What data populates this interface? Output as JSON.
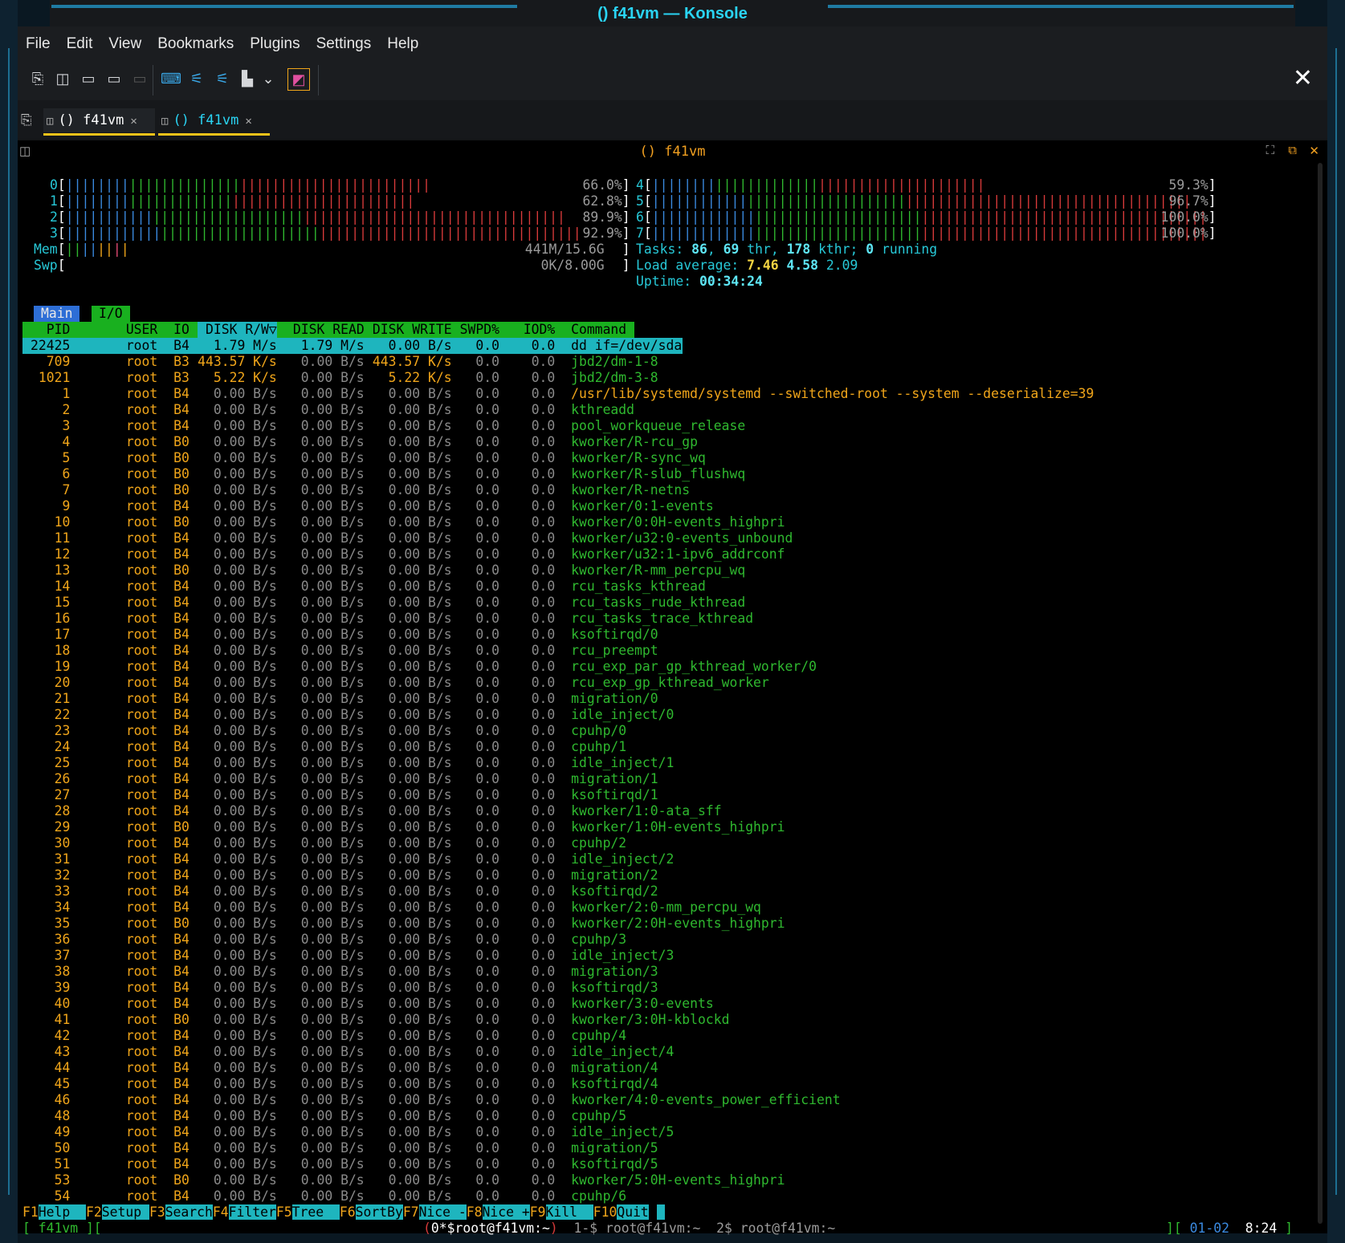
{
  "window": {
    "title": "() f41vm — Konsole"
  },
  "menu": [
    "File",
    "Edit",
    "View",
    "Bookmarks",
    "Plugins",
    "Settings",
    "Help"
  ],
  "toolbar_icons": [
    "new-tab-icon",
    "split-view-icon",
    "open-folder-icon",
    "save-icon",
    "disabled-icon",
    "keyboard-icon",
    "sliders-icon",
    "sliders-alt-icon",
    "chart-icon",
    "chevron-down-icon",
    "profile-icon"
  ],
  "tabs": [
    {
      "label": "() f41vm",
      "active": true
    },
    {
      "label": "() f41vm",
      "active": false
    }
  ],
  "terminal_title": "() f41vm",
  "cpus": [
    {
      "id": "0",
      "pct": "66.0%",
      "fill": 0.66
    },
    {
      "id": "1",
      "pct": "62.8%",
      "fill": 0.628
    },
    {
      "id": "2",
      "pct": "89.9%",
      "fill": 0.899
    },
    {
      "id": "3",
      "pct": "92.9%",
      "fill": 0.929
    },
    {
      "id": "4",
      "pct": "59.3%",
      "fill": 0.593
    },
    {
      "id": "5",
      "pct": "96.7%",
      "fill": 0.967
    },
    {
      "id": "6",
      "pct": "100.0%",
      "fill": 1.0
    },
    {
      "id": "7",
      "pct": "100.0%",
      "fill": 1.0
    }
  ],
  "mem": {
    "label": "Mem",
    "value": "441M/15.6G"
  },
  "swp": {
    "label": "Swp",
    "value": "0K/8.00G"
  },
  "tasks": {
    "label": "Tasks:",
    "count": "86",
    "thr": "69",
    "thr_label": "thr,",
    "kthr": "178",
    "kthr_label": "kthr;",
    "running": "0",
    "running_label": "running"
  },
  "load": {
    "label": "Load average:",
    "l1": "7.46",
    "l5": "4.58",
    "l15": "2.09"
  },
  "uptime": {
    "label": "Uptime:",
    "value": "00:34:24"
  },
  "screen_tabs": [
    "Main",
    "I/O"
  ],
  "columns": {
    "pid": "PID",
    "user": "USER",
    "io": "IO",
    "rw": "DISK R/W▽",
    "read": "DISK READ",
    "write": "DISK WRITE",
    "swpd": "SWPD%",
    "iod": "IOD%",
    "cmd": "Command"
  },
  "processes": [
    {
      "pid": "22425",
      "user": "root",
      "io": "B4",
      "rw": "1.79 M/s",
      "read": "1.79 M/s",
      "write": "0.00 B/s",
      "swpd": "0.0",
      "iod": "0.0",
      "cmd": "dd if=/dev/sda"
    },
    {
      "pid": "709",
      "user": "root",
      "io": "B3",
      "rw": "443.57 K/s",
      "read": "0.00 B/s",
      "write": "443.57 K/s",
      "swpd": "0.0",
      "iod": "0.0",
      "cmd": "jbd2/dm-1-8"
    },
    {
      "pid": "1021",
      "user": "root",
      "io": "B3",
      "rw": "5.22 K/s",
      "read": "0.00 B/s",
      "write": "5.22 K/s",
      "swpd": "0.0",
      "iod": "0.0",
      "cmd": "jbd2/dm-3-8"
    },
    {
      "pid": "1",
      "user": "root",
      "io": "B4",
      "rw": "0.00 B/s",
      "read": "0.00 B/s",
      "write": "0.00 B/s",
      "swpd": "0.0",
      "iod": "0.0",
      "cmd": "/usr/lib/systemd/systemd --switched-root --system --deserialize=39"
    },
    {
      "pid": "2",
      "user": "root",
      "io": "B4",
      "rw": "0.00 B/s",
      "read": "0.00 B/s",
      "write": "0.00 B/s",
      "swpd": "0.0",
      "iod": "0.0",
      "cmd": "kthreadd"
    },
    {
      "pid": "3",
      "user": "root",
      "io": "B4",
      "rw": "0.00 B/s",
      "read": "0.00 B/s",
      "write": "0.00 B/s",
      "swpd": "0.0",
      "iod": "0.0",
      "cmd": "pool_workqueue_release"
    },
    {
      "pid": "4",
      "user": "root",
      "io": "B0",
      "rw": "0.00 B/s",
      "read": "0.00 B/s",
      "write": "0.00 B/s",
      "swpd": "0.0",
      "iod": "0.0",
      "cmd": "kworker/R-rcu_gp"
    },
    {
      "pid": "5",
      "user": "root",
      "io": "B0",
      "rw": "0.00 B/s",
      "read": "0.00 B/s",
      "write": "0.00 B/s",
      "swpd": "0.0",
      "iod": "0.0",
      "cmd": "kworker/R-sync_wq"
    },
    {
      "pid": "6",
      "user": "root",
      "io": "B0",
      "rw": "0.00 B/s",
      "read": "0.00 B/s",
      "write": "0.00 B/s",
      "swpd": "0.0",
      "iod": "0.0",
      "cmd": "kworker/R-slub_flushwq"
    },
    {
      "pid": "7",
      "user": "root",
      "io": "B0",
      "rw": "0.00 B/s",
      "read": "0.00 B/s",
      "write": "0.00 B/s",
      "swpd": "0.0",
      "iod": "0.0",
      "cmd": "kworker/R-netns"
    },
    {
      "pid": "9",
      "user": "root",
      "io": "B4",
      "rw": "0.00 B/s",
      "read": "0.00 B/s",
      "write": "0.00 B/s",
      "swpd": "0.0",
      "iod": "0.0",
      "cmd": "kworker/0:1-events"
    },
    {
      "pid": "10",
      "user": "root",
      "io": "B0",
      "rw": "0.00 B/s",
      "read": "0.00 B/s",
      "write": "0.00 B/s",
      "swpd": "0.0",
      "iod": "0.0",
      "cmd": "kworker/0:0H-events_highpri"
    },
    {
      "pid": "11",
      "user": "root",
      "io": "B4",
      "rw": "0.00 B/s",
      "read": "0.00 B/s",
      "write": "0.00 B/s",
      "swpd": "0.0",
      "iod": "0.0",
      "cmd": "kworker/u32:0-events_unbound"
    },
    {
      "pid": "12",
      "user": "root",
      "io": "B4",
      "rw": "0.00 B/s",
      "read": "0.00 B/s",
      "write": "0.00 B/s",
      "swpd": "0.0",
      "iod": "0.0",
      "cmd": "kworker/u32:1-ipv6_addrconf"
    },
    {
      "pid": "13",
      "user": "root",
      "io": "B0",
      "rw": "0.00 B/s",
      "read": "0.00 B/s",
      "write": "0.00 B/s",
      "swpd": "0.0",
      "iod": "0.0",
      "cmd": "kworker/R-mm_percpu_wq"
    },
    {
      "pid": "14",
      "user": "root",
      "io": "B4",
      "rw": "0.00 B/s",
      "read": "0.00 B/s",
      "write": "0.00 B/s",
      "swpd": "0.0",
      "iod": "0.0",
      "cmd": "rcu_tasks_kthread"
    },
    {
      "pid": "15",
      "user": "root",
      "io": "B4",
      "rw": "0.00 B/s",
      "read": "0.00 B/s",
      "write": "0.00 B/s",
      "swpd": "0.0",
      "iod": "0.0",
      "cmd": "rcu_tasks_rude_kthread"
    },
    {
      "pid": "16",
      "user": "root",
      "io": "B4",
      "rw": "0.00 B/s",
      "read": "0.00 B/s",
      "write": "0.00 B/s",
      "swpd": "0.0",
      "iod": "0.0",
      "cmd": "rcu_tasks_trace_kthread"
    },
    {
      "pid": "17",
      "user": "root",
      "io": "B4",
      "rw": "0.00 B/s",
      "read": "0.00 B/s",
      "write": "0.00 B/s",
      "swpd": "0.0",
      "iod": "0.0",
      "cmd": "ksoftirqd/0"
    },
    {
      "pid": "18",
      "user": "root",
      "io": "B4",
      "rw": "0.00 B/s",
      "read": "0.00 B/s",
      "write": "0.00 B/s",
      "swpd": "0.0",
      "iod": "0.0",
      "cmd": "rcu_preempt"
    },
    {
      "pid": "19",
      "user": "root",
      "io": "B4",
      "rw": "0.00 B/s",
      "read": "0.00 B/s",
      "write": "0.00 B/s",
      "swpd": "0.0",
      "iod": "0.0",
      "cmd": "rcu_exp_par_gp_kthread_worker/0"
    },
    {
      "pid": "20",
      "user": "root",
      "io": "B4",
      "rw": "0.00 B/s",
      "read": "0.00 B/s",
      "write": "0.00 B/s",
      "swpd": "0.0",
      "iod": "0.0",
      "cmd": "rcu_exp_gp_kthread_worker"
    },
    {
      "pid": "21",
      "user": "root",
      "io": "B4",
      "rw": "0.00 B/s",
      "read": "0.00 B/s",
      "write": "0.00 B/s",
      "swpd": "0.0",
      "iod": "0.0",
      "cmd": "migration/0"
    },
    {
      "pid": "22",
      "user": "root",
      "io": "B4",
      "rw": "0.00 B/s",
      "read": "0.00 B/s",
      "write": "0.00 B/s",
      "swpd": "0.0",
      "iod": "0.0",
      "cmd": "idle_inject/0"
    },
    {
      "pid": "23",
      "user": "root",
      "io": "B4",
      "rw": "0.00 B/s",
      "read": "0.00 B/s",
      "write": "0.00 B/s",
      "swpd": "0.0",
      "iod": "0.0",
      "cmd": "cpuhp/0"
    },
    {
      "pid": "24",
      "user": "root",
      "io": "B4",
      "rw": "0.00 B/s",
      "read": "0.00 B/s",
      "write": "0.00 B/s",
      "swpd": "0.0",
      "iod": "0.0",
      "cmd": "cpuhp/1"
    },
    {
      "pid": "25",
      "user": "root",
      "io": "B4",
      "rw": "0.00 B/s",
      "read": "0.00 B/s",
      "write": "0.00 B/s",
      "swpd": "0.0",
      "iod": "0.0",
      "cmd": "idle_inject/1"
    },
    {
      "pid": "26",
      "user": "root",
      "io": "B4",
      "rw": "0.00 B/s",
      "read": "0.00 B/s",
      "write": "0.00 B/s",
      "swpd": "0.0",
      "iod": "0.0",
      "cmd": "migration/1"
    },
    {
      "pid": "27",
      "user": "root",
      "io": "B4",
      "rw": "0.00 B/s",
      "read": "0.00 B/s",
      "write": "0.00 B/s",
      "swpd": "0.0",
      "iod": "0.0",
      "cmd": "ksoftirqd/1"
    },
    {
      "pid": "28",
      "user": "root",
      "io": "B4",
      "rw": "0.00 B/s",
      "read": "0.00 B/s",
      "write": "0.00 B/s",
      "swpd": "0.0",
      "iod": "0.0",
      "cmd": "kworker/1:0-ata_sff"
    },
    {
      "pid": "29",
      "user": "root",
      "io": "B0",
      "rw": "0.00 B/s",
      "read": "0.00 B/s",
      "write": "0.00 B/s",
      "swpd": "0.0",
      "iod": "0.0",
      "cmd": "kworker/1:0H-events_highpri"
    },
    {
      "pid": "30",
      "user": "root",
      "io": "B4",
      "rw": "0.00 B/s",
      "read": "0.00 B/s",
      "write": "0.00 B/s",
      "swpd": "0.0",
      "iod": "0.0",
      "cmd": "cpuhp/2"
    },
    {
      "pid": "31",
      "user": "root",
      "io": "B4",
      "rw": "0.00 B/s",
      "read": "0.00 B/s",
      "write": "0.00 B/s",
      "swpd": "0.0",
      "iod": "0.0",
      "cmd": "idle_inject/2"
    },
    {
      "pid": "32",
      "user": "root",
      "io": "B4",
      "rw": "0.00 B/s",
      "read": "0.00 B/s",
      "write": "0.00 B/s",
      "swpd": "0.0",
      "iod": "0.0",
      "cmd": "migration/2"
    },
    {
      "pid": "33",
      "user": "root",
      "io": "B4",
      "rw": "0.00 B/s",
      "read": "0.00 B/s",
      "write": "0.00 B/s",
      "swpd": "0.0",
      "iod": "0.0",
      "cmd": "ksoftirqd/2"
    },
    {
      "pid": "34",
      "user": "root",
      "io": "B4",
      "rw": "0.00 B/s",
      "read": "0.00 B/s",
      "write": "0.00 B/s",
      "swpd": "0.0",
      "iod": "0.0",
      "cmd": "kworker/2:0-mm_percpu_wq"
    },
    {
      "pid": "35",
      "user": "root",
      "io": "B0",
      "rw": "0.00 B/s",
      "read": "0.00 B/s",
      "write": "0.00 B/s",
      "swpd": "0.0",
      "iod": "0.0",
      "cmd": "kworker/2:0H-events_highpri"
    },
    {
      "pid": "36",
      "user": "root",
      "io": "B4",
      "rw": "0.00 B/s",
      "read": "0.00 B/s",
      "write": "0.00 B/s",
      "swpd": "0.0",
      "iod": "0.0",
      "cmd": "cpuhp/3"
    },
    {
      "pid": "37",
      "user": "root",
      "io": "B4",
      "rw": "0.00 B/s",
      "read": "0.00 B/s",
      "write": "0.00 B/s",
      "swpd": "0.0",
      "iod": "0.0",
      "cmd": "idle_inject/3"
    },
    {
      "pid": "38",
      "user": "root",
      "io": "B4",
      "rw": "0.00 B/s",
      "read": "0.00 B/s",
      "write": "0.00 B/s",
      "swpd": "0.0",
      "iod": "0.0",
      "cmd": "migration/3"
    },
    {
      "pid": "39",
      "user": "root",
      "io": "B4",
      "rw": "0.00 B/s",
      "read": "0.00 B/s",
      "write": "0.00 B/s",
      "swpd": "0.0",
      "iod": "0.0",
      "cmd": "ksoftirqd/3"
    },
    {
      "pid": "40",
      "user": "root",
      "io": "B4",
      "rw": "0.00 B/s",
      "read": "0.00 B/s",
      "write": "0.00 B/s",
      "swpd": "0.0",
      "iod": "0.0",
      "cmd": "kworker/3:0-events"
    },
    {
      "pid": "41",
      "user": "root",
      "io": "B0",
      "rw": "0.00 B/s",
      "read": "0.00 B/s",
      "write": "0.00 B/s",
      "swpd": "0.0",
      "iod": "0.0",
      "cmd": "kworker/3:0H-kblockd"
    },
    {
      "pid": "42",
      "user": "root",
      "io": "B4",
      "rw": "0.00 B/s",
      "read": "0.00 B/s",
      "write": "0.00 B/s",
      "swpd": "0.0",
      "iod": "0.0",
      "cmd": "cpuhp/4"
    },
    {
      "pid": "43",
      "user": "root",
      "io": "B4",
      "rw": "0.00 B/s",
      "read": "0.00 B/s",
      "write": "0.00 B/s",
      "swpd": "0.0",
      "iod": "0.0",
      "cmd": "idle_inject/4"
    },
    {
      "pid": "44",
      "user": "root",
      "io": "B4",
      "rw": "0.00 B/s",
      "read": "0.00 B/s",
      "write": "0.00 B/s",
      "swpd": "0.0",
      "iod": "0.0",
      "cmd": "migration/4"
    },
    {
      "pid": "45",
      "user": "root",
      "io": "B4",
      "rw": "0.00 B/s",
      "read": "0.00 B/s",
      "write": "0.00 B/s",
      "swpd": "0.0",
      "iod": "0.0",
      "cmd": "ksoftirqd/4"
    },
    {
      "pid": "46",
      "user": "root",
      "io": "B4",
      "rw": "0.00 B/s",
      "read": "0.00 B/s",
      "write": "0.00 B/s",
      "swpd": "0.0",
      "iod": "0.0",
      "cmd": "kworker/4:0-events_power_efficient"
    },
    {
      "pid": "48",
      "user": "root",
      "io": "B4",
      "rw": "0.00 B/s",
      "read": "0.00 B/s",
      "write": "0.00 B/s",
      "swpd": "0.0",
      "iod": "0.0",
      "cmd": "cpuhp/5"
    },
    {
      "pid": "49",
      "user": "root",
      "io": "B4",
      "rw": "0.00 B/s",
      "read": "0.00 B/s",
      "write": "0.00 B/s",
      "swpd": "0.0",
      "iod": "0.0",
      "cmd": "idle_inject/5"
    },
    {
      "pid": "50",
      "user": "root",
      "io": "B4",
      "rw": "0.00 B/s",
      "read": "0.00 B/s",
      "write": "0.00 B/s",
      "swpd": "0.0",
      "iod": "0.0",
      "cmd": "migration/5"
    },
    {
      "pid": "51",
      "user": "root",
      "io": "B4",
      "rw": "0.00 B/s",
      "read": "0.00 B/s",
      "write": "0.00 B/s",
      "swpd": "0.0",
      "iod": "0.0",
      "cmd": "ksoftirqd/5"
    },
    {
      "pid": "53",
      "user": "root",
      "io": "B0",
      "rw": "0.00 B/s",
      "read": "0.00 B/s",
      "write": "0.00 B/s",
      "swpd": "0.0",
      "iod": "0.0",
      "cmd": "kworker/5:0H-events_highpri"
    },
    {
      "pid": "54",
      "user": "root",
      "io": "B4",
      "rw": "0.00 B/s",
      "read": "0.00 B/s",
      "write": "0.00 B/s",
      "swpd": "0.0",
      "iod": "0.0",
      "cmd": "cpuhp/6"
    }
  ],
  "fkeys": [
    {
      "key": "F1",
      "label": "Help  "
    },
    {
      "key": "F2",
      "label": "Setup "
    },
    {
      "key": "F3",
      "label": "Search"
    },
    {
      "key": "F4",
      "label": "Filter"
    },
    {
      "key": "F5",
      "label": "Tree  "
    },
    {
      "key": "F6",
      "label": "SortBy"
    },
    {
      "key": "F7",
      "label": "Nice -"
    },
    {
      "key": "F8",
      "label": "Nice +"
    },
    {
      "key": "F9",
      "label": "Kill  "
    },
    {
      "key": "F10",
      "label": "Quit"
    }
  ],
  "statusline": {
    "left": "[ f41vm ][",
    "session": "(0*$root@f41vm:~)",
    "win1": "1-$ root@f41vm:~",
    "win2": "2$ root@f41vm:~",
    "sep": "][",
    "date": "01-02",
    "time": "8:24",
    "end": "]"
  },
  "colors": {
    "accent": "#2ad4f4",
    "tab_underline": "#f2c31a",
    "header_bg": "#19b01f",
    "selected_bg": "#1eb5be"
  }
}
